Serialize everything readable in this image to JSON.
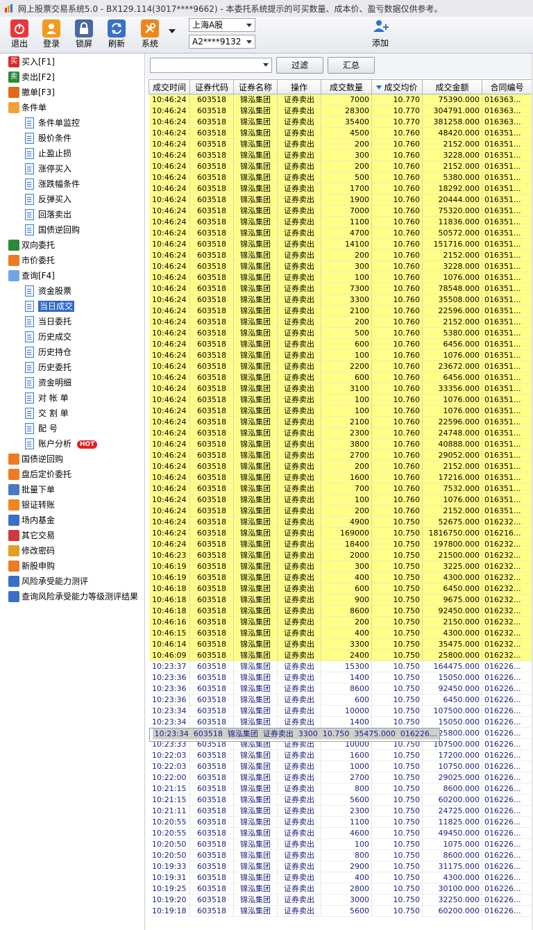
{
  "window": {
    "title": "网上股票交易系统5.0 - BX129.114(3017****9662) - 本委托系统提示的可买数量、成本价、盈亏数据仅供参考。"
  },
  "toolbar": {
    "buttons": [
      {
        "label": "退出",
        "icon": "power-icon"
      },
      {
        "label": "登录",
        "icon": "user-icon"
      },
      {
        "label": "锁屏",
        "icon": "lock-icon"
      },
      {
        "label": "刷新",
        "icon": "refresh-icon"
      },
      {
        "label": "系统",
        "icon": "tools-icon"
      }
    ],
    "market": "上海A股",
    "account": "A2****9132",
    "add_label": "添加"
  },
  "sidebar": {
    "items": [
      {
        "label": "买入[F1]",
        "badge": "买"
      },
      {
        "label": "卖出[F2]",
        "badge": "卖"
      },
      {
        "label": "撤单[F3]"
      },
      {
        "label": "条件单"
      },
      {
        "label": "条件单监控"
      },
      {
        "label": "股价条件"
      },
      {
        "label": "止盈止损"
      },
      {
        "label": "涨停买入"
      },
      {
        "label": "涨跌幅条件"
      },
      {
        "label": "反弹买入"
      },
      {
        "label": "回落卖出"
      },
      {
        "label": "国债逆回购"
      },
      {
        "label": "双向委托"
      },
      {
        "label": "市价委托"
      },
      {
        "label": "查询[F4]"
      },
      {
        "label": "资金股票"
      },
      {
        "label": "当日成交"
      },
      {
        "label": "当日委托"
      },
      {
        "label": "历史成交"
      },
      {
        "label": "历史持仓"
      },
      {
        "label": "历史委托"
      },
      {
        "label": "资金明细"
      },
      {
        "label": "对 帐 单"
      },
      {
        "label": "交 割 单"
      },
      {
        "label": "配    号"
      },
      {
        "label": "账户分析",
        "hot": "HOT"
      },
      {
        "label": "国债逆回购"
      },
      {
        "label": "盘后定价委托"
      },
      {
        "label": "批量下单"
      },
      {
        "label": "银证转账"
      },
      {
        "label": "场内基金"
      },
      {
        "label": "其它交易"
      },
      {
        "label": "修改密码"
      },
      {
        "label": "新股申购"
      },
      {
        "label": "风险承受能力测评"
      },
      {
        "label": "查询风险承受能力等级测评结果"
      }
    ]
  },
  "filter": {
    "filter_label": "过滤",
    "summary_label": "汇总"
  },
  "table": {
    "columns": [
      "成交时间",
      "证券代码",
      "证券名称",
      "操作",
      "成交数量",
      "成交均价",
      "成交金额",
      "合同编号"
    ],
    "rows": [
      {
        "t": "10:46:24",
        "code": "603518",
        "name": "锦泓集团",
        "op": "证券卖出",
        "qty": "7000",
        "price": "10.770",
        "amt": "75390.000",
        "no": "016363...",
        "h": 1
      },
      {
        "t": "10:46:24",
        "code": "603518",
        "name": "锦泓集团",
        "op": "证券卖出",
        "qty": "28300",
        "price": "10.770",
        "amt": "304791.000",
        "no": "016363...",
        "h": 1
      },
      {
        "t": "10:46:24",
        "code": "603518",
        "name": "锦泓集团",
        "op": "证券卖出",
        "qty": "35400",
        "price": "10.770",
        "amt": "381258.000",
        "no": "016363...",
        "h": 1
      },
      {
        "t": "10:46:24",
        "code": "603518",
        "name": "锦泓集团",
        "op": "证券卖出",
        "qty": "4500",
        "price": "10.760",
        "amt": "48420.000",
        "no": "016351...",
        "h": 1
      },
      {
        "t": "10:46:24",
        "code": "603518",
        "name": "锦泓集团",
        "op": "证券卖出",
        "qty": "200",
        "price": "10.760",
        "amt": "2152.000",
        "no": "016351...",
        "h": 1
      },
      {
        "t": "10:46:24",
        "code": "603518",
        "name": "锦泓集团",
        "op": "证券卖出",
        "qty": "300",
        "price": "10.760",
        "amt": "3228.000",
        "no": "016351...",
        "h": 1
      },
      {
        "t": "10:46:24",
        "code": "603518",
        "name": "锦泓集团",
        "op": "证券卖出",
        "qty": "200",
        "price": "10.760",
        "amt": "2152.000",
        "no": "016351...",
        "h": 1
      },
      {
        "t": "10:46:24",
        "code": "603518",
        "name": "锦泓集团",
        "op": "证券卖出",
        "qty": "500",
        "price": "10.760",
        "amt": "5380.000",
        "no": "016351...",
        "h": 1
      },
      {
        "t": "10:46:24",
        "code": "603518",
        "name": "锦泓集团",
        "op": "证券卖出",
        "qty": "1700",
        "price": "10.760",
        "amt": "18292.000",
        "no": "016351...",
        "h": 1
      },
      {
        "t": "10:46:24",
        "code": "603518",
        "name": "锦泓集团",
        "op": "证券卖出",
        "qty": "1900",
        "price": "10.760",
        "amt": "20444.000",
        "no": "016351...",
        "h": 1
      },
      {
        "t": "10:46:24",
        "code": "603518",
        "name": "锦泓集团",
        "op": "证券卖出",
        "qty": "7000",
        "price": "10.760",
        "amt": "75320.000",
        "no": "016351...",
        "h": 1
      },
      {
        "t": "10:46:24",
        "code": "603518",
        "name": "锦泓集团",
        "op": "证券卖出",
        "qty": "1100",
        "price": "10.760",
        "amt": "11836.000",
        "no": "016351...",
        "h": 1
      },
      {
        "t": "10:46:24",
        "code": "603518",
        "name": "锦泓集团",
        "op": "证券卖出",
        "qty": "4700",
        "price": "10.760",
        "amt": "50572.000",
        "no": "016351...",
        "h": 1
      },
      {
        "t": "10:46:24",
        "code": "603518",
        "name": "锦泓集团",
        "op": "证券卖出",
        "qty": "14100",
        "price": "10.760",
        "amt": "151716.000",
        "no": "016351...",
        "h": 1
      },
      {
        "t": "10:46:24",
        "code": "603518",
        "name": "锦泓集团",
        "op": "证券卖出",
        "qty": "200",
        "price": "10.760",
        "amt": "2152.000",
        "no": "016351...",
        "h": 1
      },
      {
        "t": "10:46:24",
        "code": "603518",
        "name": "锦泓集团",
        "op": "证券卖出",
        "qty": "300",
        "price": "10.760",
        "amt": "3228.000",
        "no": "016351...",
        "h": 1
      },
      {
        "t": "10:46:24",
        "code": "603518",
        "name": "锦泓集团",
        "op": "证券卖出",
        "qty": "100",
        "price": "10.760",
        "amt": "1076.000",
        "no": "016351...",
        "h": 1
      },
      {
        "t": "10:46:24",
        "code": "603518",
        "name": "锦泓集团",
        "op": "证券卖出",
        "qty": "7300",
        "price": "10.760",
        "amt": "78548.000",
        "no": "016351...",
        "h": 1
      },
      {
        "t": "10:46:24",
        "code": "603518",
        "name": "锦泓集团",
        "op": "证券卖出",
        "qty": "3300",
        "price": "10.760",
        "amt": "35508.000",
        "no": "016351...",
        "h": 1
      },
      {
        "t": "10:46:24",
        "code": "603518",
        "name": "锦泓集团",
        "op": "证券卖出",
        "qty": "2100",
        "price": "10.760",
        "amt": "22596.000",
        "no": "016351...",
        "h": 1
      },
      {
        "t": "10:46:24",
        "code": "603518",
        "name": "锦泓集团",
        "op": "证券卖出",
        "qty": "200",
        "price": "10.760",
        "amt": "2152.000",
        "no": "016351...",
        "h": 1
      },
      {
        "t": "10:46:24",
        "code": "603518",
        "name": "锦泓集团",
        "op": "证券卖出",
        "qty": "500",
        "price": "10.760",
        "amt": "5380.000",
        "no": "016351...",
        "h": 1
      },
      {
        "t": "10:46:24",
        "code": "603518",
        "name": "锦泓集团",
        "op": "证券卖出",
        "qty": "600",
        "price": "10.760",
        "amt": "6456.000",
        "no": "016351...",
        "h": 1
      },
      {
        "t": "10:46:24",
        "code": "603518",
        "name": "锦泓集团",
        "op": "证券卖出",
        "qty": "100",
        "price": "10.760",
        "amt": "1076.000",
        "no": "016351...",
        "h": 1
      },
      {
        "t": "10:46:24",
        "code": "603518",
        "name": "锦泓集团",
        "op": "证券卖出",
        "qty": "2200",
        "price": "10.760",
        "amt": "23672.000",
        "no": "016351...",
        "h": 1
      },
      {
        "t": "10:46:24",
        "code": "603518",
        "name": "锦泓集团",
        "op": "证券卖出",
        "qty": "600",
        "price": "10.760",
        "amt": "6456.000",
        "no": "016351...",
        "h": 1
      },
      {
        "t": "10:46:24",
        "code": "603518",
        "name": "锦泓集团",
        "op": "证券卖出",
        "qty": "3100",
        "price": "10.760",
        "amt": "33356.000",
        "no": "016351...",
        "h": 1
      },
      {
        "t": "10:46:24",
        "code": "603518",
        "name": "锦泓集团",
        "op": "证券卖出",
        "qty": "100",
        "price": "10.760",
        "amt": "1076.000",
        "no": "016351...",
        "h": 1
      },
      {
        "t": "10:46:24",
        "code": "603518",
        "name": "锦泓集团",
        "op": "证券卖出",
        "qty": "100",
        "price": "10.760",
        "amt": "1076.000",
        "no": "016351...",
        "h": 1
      },
      {
        "t": "10:46:24",
        "code": "603518",
        "name": "锦泓集团",
        "op": "证券卖出",
        "qty": "2100",
        "price": "10.760",
        "amt": "22596.000",
        "no": "016351...",
        "h": 1
      },
      {
        "t": "10:46:24",
        "code": "603518",
        "name": "锦泓集团",
        "op": "证券卖出",
        "qty": "2300",
        "price": "10.760",
        "amt": "24748.000",
        "no": "016351...",
        "h": 1
      },
      {
        "t": "10:46:24",
        "code": "603518",
        "name": "锦泓集团",
        "op": "证券卖出",
        "qty": "3800",
        "price": "10.760",
        "amt": "40888.000",
        "no": "016351...",
        "h": 1
      },
      {
        "t": "10:46:24",
        "code": "603518",
        "name": "锦泓集团",
        "op": "证券卖出",
        "qty": "2700",
        "price": "10.760",
        "amt": "29052.000",
        "no": "016351...",
        "h": 1
      },
      {
        "t": "10:46:24",
        "code": "603518",
        "name": "锦泓集团",
        "op": "证券卖出",
        "qty": "200",
        "price": "10.760",
        "amt": "2152.000",
        "no": "016351...",
        "h": 1
      },
      {
        "t": "10:46:24",
        "code": "603518",
        "name": "锦泓集团",
        "op": "证券卖出",
        "qty": "1600",
        "price": "10.760",
        "amt": "17216.000",
        "no": "016351...",
        "h": 1
      },
      {
        "t": "10:46:24",
        "code": "603518",
        "name": "锦泓集团",
        "op": "证券卖出",
        "qty": "700",
        "price": "10.760",
        "amt": "7532.000",
        "no": "016351...",
        "h": 1
      },
      {
        "t": "10:46:24",
        "code": "603518",
        "name": "锦泓集团",
        "op": "证券卖出",
        "qty": "100",
        "price": "10.760",
        "amt": "1076.000",
        "no": "016351...",
        "h": 1
      },
      {
        "t": "10:46:24",
        "code": "603518",
        "name": "锦泓集团",
        "op": "证券卖出",
        "qty": "200",
        "price": "10.760",
        "amt": "2152.000",
        "no": "016351...",
        "h": 1
      },
      {
        "t": "10:46:24",
        "code": "603518",
        "name": "锦泓集团",
        "op": "证券卖出",
        "qty": "4900",
        "price": "10.750",
        "amt": "52675.000",
        "no": "016232...",
        "h": 1
      },
      {
        "t": "10:46:24",
        "code": "603518",
        "name": "锦泓集团",
        "op": "证券卖出",
        "qty": "169000",
        "price": "10.750",
        "amt": "1816750.000",
        "no": "016216...",
        "h": 1
      },
      {
        "t": "10:46:24",
        "code": "603518",
        "name": "锦泓集团",
        "op": "证券卖出",
        "qty": "18400",
        "price": "10.750",
        "amt": "197800.000",
        "no": "016232...",
        "h": 1
      },
      {
        "t": "10:46:23",
        "code": "603518",
        "name": "锦泓集团",
        "op": "证券卖出",
        "qty": "2000",
        "price": "10.750",
        "amt": "21500.000",
        "no": "016232...",
        "h": 1
      },
      {
        "t": "10:46:19",
        "code": "603518",
        "name": "锦泓集团",
        "op": "证券卖出",
        "qty": "300",
        "price": "10.750",
        "amt": "3225.000",
        "no": "016232...",
        "h": 1
      },
      {
        "t": "10:46:19",
        "code": "603518",
        "name": "锦泓集团",
        "op": "证券卖出",
        "qty": "400",
        "price": "10.750",
        "amt": "4300.000",
        "no": "016232...",
        "h": 1
      },
      {
        "t": "10:46:18",
        "code": "603518",
        "name": "锦泓集团",
        "op": "证券卖出",
        "qty": "600",
        "price": "10.750",
        "amt": "6450.000",
        "no": "016232...",
        "h": 1
      },
      {
        "t": "10:46:18",
        "code": "603518",
        "name": "锦泓集团",
        "op": "证券卖出",
        "qty": "900",
        "price": "10.750",
        "amt": "9675.000",
        "no": "016232...",
        "h": 1
      },
      {
        "t": "10:46:18",
        "code": "603518",
        "name": "锦泓集团",
        "op": "证券卖出",
        "qty": "8600",
        "price": "10.750",
        "amt": "92450.000",
        "no": "016232...",
        "h": 1
      },
      {
        "t": "10:46:16",
        "code": "603518",
        "name": "锦泓集团",
        "op": "证券卖出",
        "qty": "200",
        "price": "10.750",
        "amt": "2150.000",
        "no": "016232...",
        "h": 1
      },
      {
        "t": "10:46:15",
        "code": "603518",
        "name": "锦泓集团",
        "op": "证券卖出",
        "qty": "400",
        "price": "10.750",
        "amt": "4300.000",
        "no": "016232...",
        "h": 1
      },
      {
        "t": "10:46:14",
        "code": "603518",
        "name": "锦泓集团",
        "op": "证券卖出",
        "qty": "3300",
        "price": "10.750",
        "amt": "35475.000",
        "no": "016232...",
        "h": 1
      },
      {
        "t": "10:46:09",
        "code": "603518",
        "name": "锦泓集团",
        "op": "证券卖出",
        "qty": "2400",
        "price": "10.750",
        "amt": "25800.000",
        "no": "016232...",
        "h": 1
      },
      {
        "t": "10:23:37",
        "code": "603518",
        "name": "锦泓集团",
        "op": "证券卖出",
        "qty": "15300",
        "price": "10.750",
        "amt": "164475.000",
        "no": "016226...",
        "h": 0
      },
      {
        "t": "10:23:36",
        "code": "603518",
        "name": "锦泓集团",
        "op": "证券卖出",
        "qty": "1400",
        "price": "10.750",
        "amt": "15050.000",
        "no": "016226...",
        "h": 0
      },
      {
        "t": "10:23:36",
        "code": "603518",
        "name": "锦泓集团",
        "op": "证券卖出",
        "qty": "8600",
        "price": "10.750",
        "amt": "92450.000",
        "no": "016226...",
        "h": 0
      },
      {
        "t": "10:23:36",
        "code": "603518",
        "name": "锦泓集团",
        "op": "证券卖出",
        "qty": "600",
        "price": "10.750",
        "amt": "6450.000",
        "no": "016226...",
        "h": 0
      },
      {
        "t": "10:23:34",
        "code": "603518",
        "name": "锦泓集团",
        "op": "证券卖出",
        "qty": "10000",
        "price": "10.750",
        "amt": "107500.000",
        "no": "016226...",
        "h": 0
      },
      {
        "t": "10:23:34",
        "code": "603518",
        "name": "锦泓集团",
        "op": "证券卖出",
        "qty": "1400",
        "price": "10.750",
        "amt": "15050.000",
        "no": "016226...",
        "h": 0
      },
      {
        "t": "10:23:34",
        "code": "603518",
        "name": "锦泓集团",
        "op": "证券卖出",
        "qty": "3300",
        "price": "10.750",
        "amt": "35475.000",
        "no": "016226...",
        "h": 2
      },
      {
        "t": "10:23:34",
        "code": "603518",
        "name": "锦泓集团",
        "op": "证券卖出",
        "qty": "2400",
        "price": "10.750",
        "amt": "25800.000",
        "no": "016226...",
        "h": 0
      },
      {
        "t": "10:23:33",
        "code": "603518",
        "name": "锦泓集团",
        "op": "证券卖出",
        "qty": "10000",
        "price": "10.750",
        "amt": "107500.000",
        "no": "016226...",
        "h": 0
      },
      {
        "t": "10:22:03",
        "code": "603518",
        "name": "锦泓集团",
        "op": "证券卖出",
        "qty": "1600",
        "price": "10.750",
        "amt": "17200.000",
        "no": "016226...",
        "h": 0
      },
      {
        "t": "10:22:03",
        "code": "603518",
        "name": "锦泓集团",
        "op": "证券卖出",
        "qty": "1000",
        "price": "10.750",
        "amt": "10750.000",
        "no": "016226...",
        "h": 0
      },
      {
        "t": "10:22:00",
        "code": "603518",
        "name": "锦泓集团",
        "op": "证券卖出",
        "qty": "2700",
        "price": "10.750",
        "amt": "29025.000",
        "no": "016226...",
        "h": 0
      },
      {
        "t": "10:21:15",
        "code": "603518",
        "name": "锦泓集团",
        "op": "证券卖出",
        "qty": "800",
        "price": "10.750",
        "amt": "8600.000",
        "no": "016226...",
        "h": 0
      },
      {
        "t": "10:21:15",
        "code": "603518",
        "name": "锦泓集团",
        "op": "证券卖出",
        "qty": "5600",
        "price": "10.750",
        "amt": "60200.000",
        "no": "016226...",
        "h": 0
      },
      {
        "t": "10:21:11",
        "code": "603518",
        "name": "锦泓集团",
        "op": "证券卖出",
        "qty": "2300",
        "price": "10.750",
        "amt": "24725.000",
        "no": "016226...",
        "h": 0
      },
      {
        "t": "10:20:55",
        "code": "603518",
        "name": "锦泓集团",
        "op": "证券卖出",
        "qty": "1100",
        "price": "10.750",
        "amt": "11825.000",
        "no": "016226...",
        "h": 0
      },
      {
        "t": "10:20:55",
        "code": "603518",
        "name": "锦泓集团",
        "op": "证券卖出",
        "qty": "4600",
        "price": "10.750",
        "amt": "49450.000",
        "no": "016226...",
        "h": 0
      },
      {
        "t": "10:20:50",
        "code": "603518",
        "name": "锦泓集团",
        "op": "证券卖出",
        "qty": "100",
        "price": "10.750",
        "amt": "1075.000",
        "no": "016226...",
        "h": 0
      },
      {
        "t": "10:20:50",
        "code": "603518",
        "name": "锦泓集团",
        "op": "证券卖出",
        "qty": "800",
        "price": "10.750",
        "amt": "8600.000",
        "no": "016226...",
        "h": 0
      },
      {
        "t": "10:19:33",
        "code": "603518",
        "name": "锦泓集团",
        "op": "证券卖出",
        "qty": "2900",
        "price": "10.750",
        "amt": "31175.000",
        "no": "016226...",
        "h": 0
      },
      {
        "t": "10:19:31",
        "code": "603518",
        "name": "锦泓集团",
        "op": "证券卖出",
        "qty": "400",
        "price": "10.750",
        "amt": "4300.000",
        "no": "016226...",
        "h": 0
      },
      {
        "t": "10:19:25",
        "code": "603518",
        "name": "锦泓集团",
        "op": "证券卖出",
        "qty": "2800",
        "price": "10.750",
        "amt": "30100.000",
        "no": "016226...",
        "h": 0
      },
      {
        "t": "10:19:20",
        "code": "603518",
        "name": "锦泓集团",
        "op": "证券卖出",
        "qty": "3000",
        "price": "10.750",
        "amt": "32250.000",
        "no": "016226...",
        "h": 0
      },
      {
        "t": "10:19:18",
        "code": "603518",
        "name": "锦泓集团",
        "op": "证券卖出",
        "qty": "5600",
        "price": "10.750",
        "amt": "60200.000",
        "no": "016226...",
        "h": 0
      }
    ]
  }
}
